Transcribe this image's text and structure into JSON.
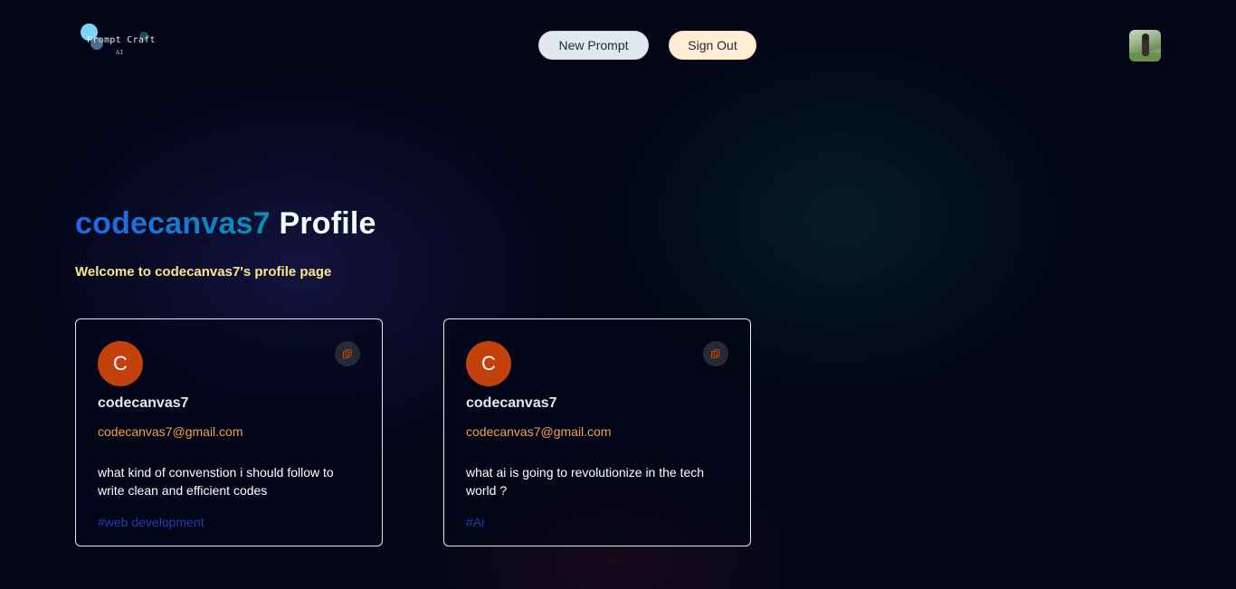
{
  "nav": {
    "logo_text": "Prompt Craft",
    "logo_sub": "AI",
    "new_prompt_label": "New Prompt",
    "sign_out_label": "Sign Out"
  },
  "profile": {
    "name": "codecanvas7",
    "title_suffix": "Profile",
    "description": "Welcome to codecanvas7's profile page"
  },
  "posts": [
    {
      "avatar_letter": "C",
      "username": "codecanvas7",
      "email": "codecanvas7@gmail.com",
      "prompt": "what kind of convenstion i should follow to write clean and efficient codes",
      "tag": "#web development"
    },
    {
      "avatar_letter": "C",
      "username": "codecanvas7",
      "email": "codecanvas7@gmail.com",
      "prompt": "what ai is going to revolutionize in the tech world ?",
      "tag": "#Ai"
    }
  ],
  "colors": {
    "background": "#020617",
    "avatar_bg": "#c2410c",
    "email": "#f59e4c",
    "tag": "#1e40af",
    "subtitle": "#fde68a",
    "title_gradient_start": "#2563eb",
    "title_gradient_end": "#0891b2"
  },
  "icons": {
    "copy": "copy-icon",
    "logo": "logo-icon"
  }
}
